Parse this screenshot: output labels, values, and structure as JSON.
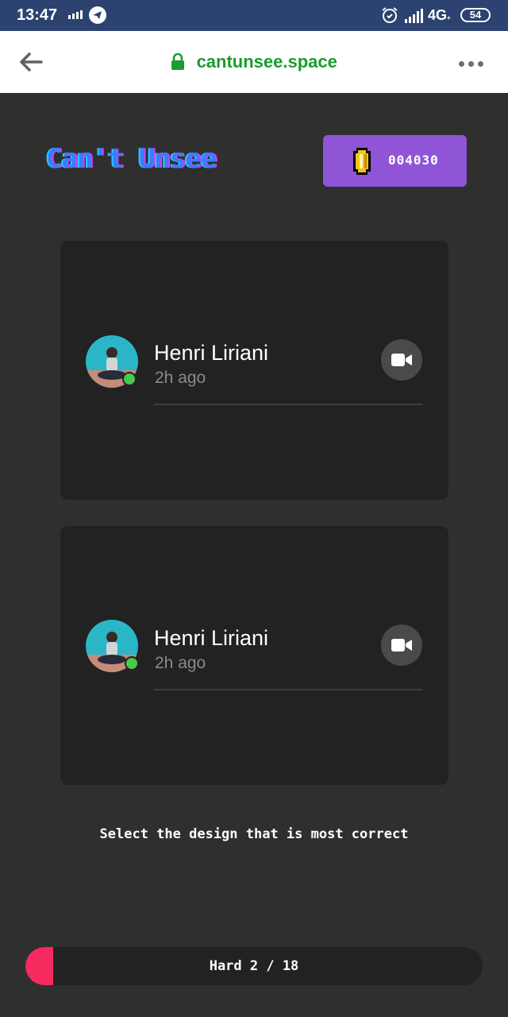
{
  "status_bar": {
    "time": "13:47",
    "network": "4G",
    "network_sub": "+",
    "battery": "54"
  },
  "browser": {
    "url": "cantunsee.space"
  },
  "header": {
    "logo_text": "Can't Unsee",
    "coin_count": "004030"
  },
  "cards": [
    {
      "name": "Henri Liriani",
      "time": "2h ago"
    },
    {
      "name": "Henri Liriani",
      "time": "2h ago"
    }
  ],
  "prompt": "Select the design that is most correct",
  "progress": {
    "label": "Hard 2 / 18",
    "fraction": 0.06
  },
  "colors": {
    "accent_purple": "#8f55d6",
    "progress_red": "#f52a5e",
    "online_green": "#47c94a",
    "url_green": "#1a9c2e"
  }
}
